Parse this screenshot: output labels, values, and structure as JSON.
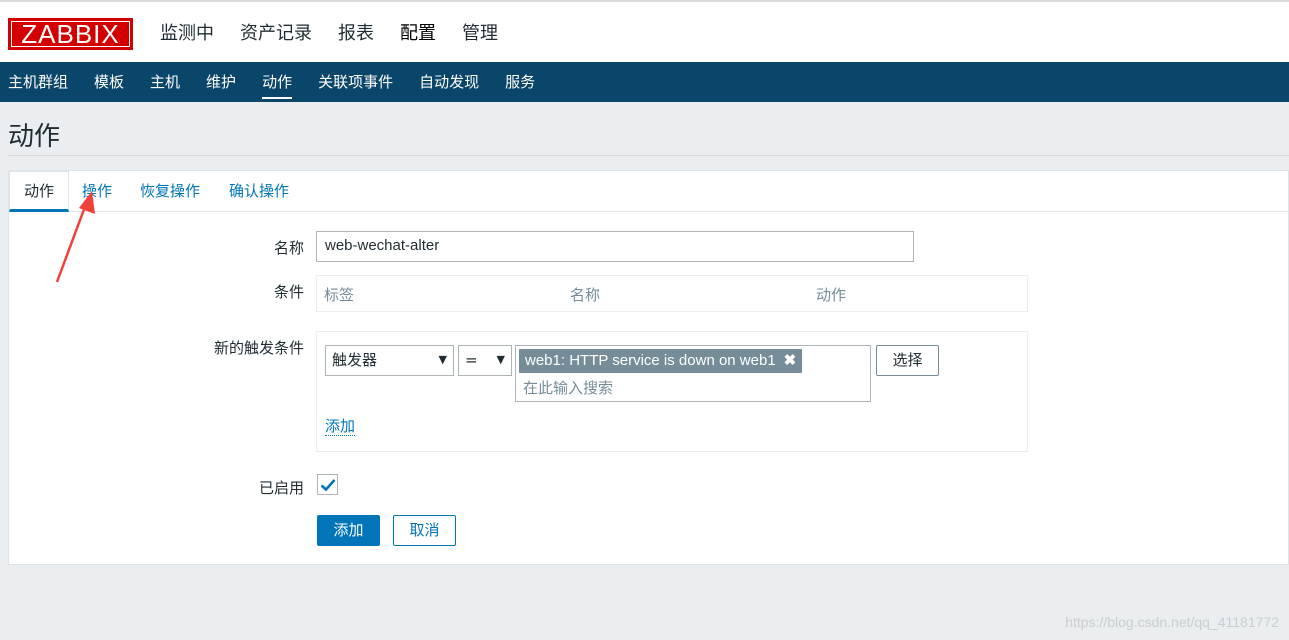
{
  "header": {
    "logo": "ZABBIX",
    "nav": [
      {
        "label": "监测中"
      },
      {
        "label": "资产记录"
      },
      {
        "label": "报表"
      },
      {
        "label": "配置"
      },
      {
        "label": "管理"
      }
    ]
  },
  "subnav": {
    "items": [
      {
        "label": "主机群组"
      },
      {
        "label": "模板"
      },
      {
        "label": "主机"
      },
      {
        "label": "维护"
      },
      {
        "label": "动作"
      },
      {
        "label": "关联项事件"
      },
      {
        "label": "自动发现"
      },
      {
        "label": "服务"
      }
    ]
  },
  "page": {
    "title": "动作"
  },
  "tabs": [
    {
      "label": "动作"
    },
    {
      "label": "操作"
    },
    {
      "label": "恢复操作"
    },
    {
      "label": "确认操作"
    }
  ],
  "form": {
    "name_label": "名称",
    "name_value": "web-wechat-alter",
    "conditions_label": "条件",
    "conditions_headers": [
      "标签",
      "名称",
      "动作"
    ],
    "new_condition_label": "新的触发条件",
    "condition_type": "触发器",
    "operator": "=",
    "selected_trigger": "web1: HTTP service is down on web1",
    "chip_remove": "✖",
    "search_placeholder": "在此输入搜索",
    "select_button": "选择",
    "add_link": "添加",
    "enabled_label": "已启用",
    "enabled": true,
    "submit_button": "添加",
    "cancel_button": "取消"
  },
  "colors": {
    "brand": "#d40000",
    "nav_bg": "#0a466a",
    "accent": "#0275b8",
    "annotation_arrow": "#f0423b"
  },
  "watermark": "https://blog.csdn.net/qq_41181772"
}
